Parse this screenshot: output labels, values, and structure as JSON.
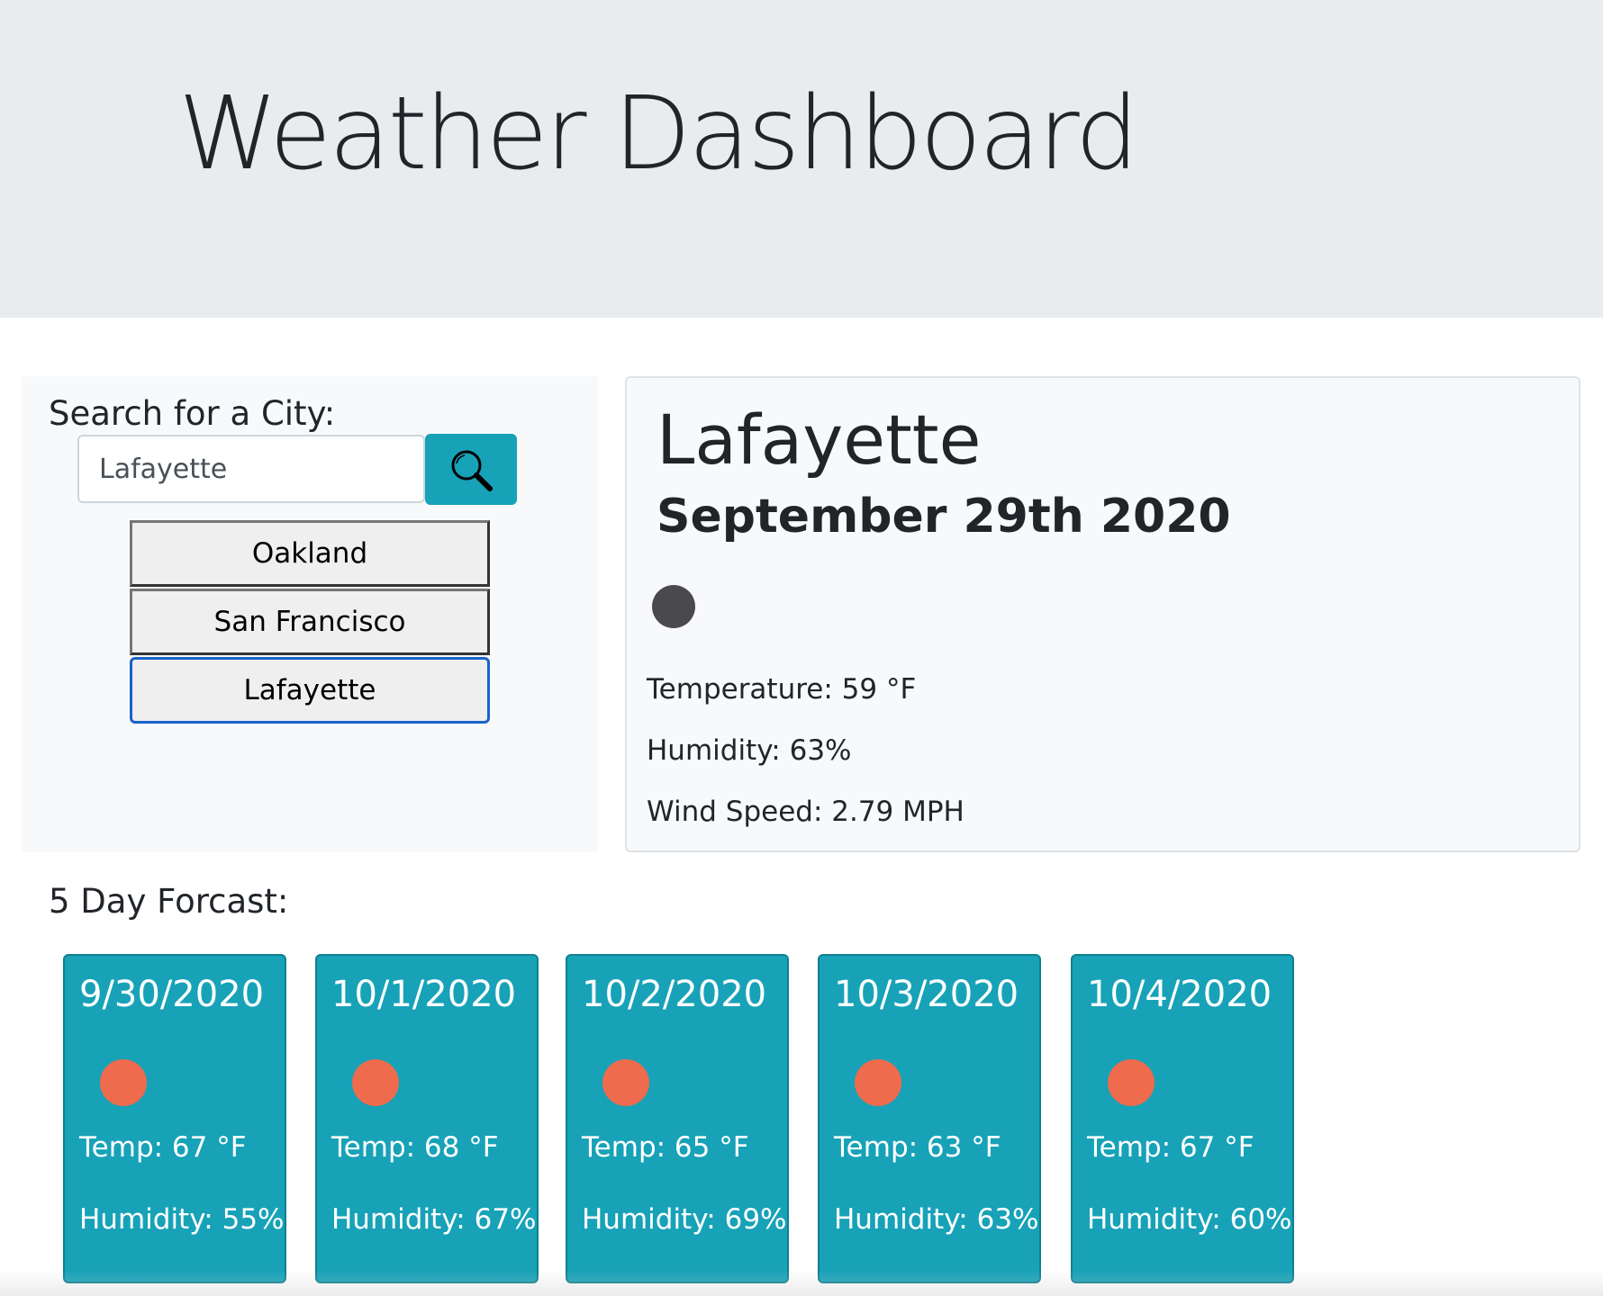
{
  "header": {
    "title": "Weather Dashboard"
  },
  "search": {
    "label": "Search for a City:",
    "input_value": "Lafayette",
    "button_icon": "search-icon",
    "history": [
      "Oakland",
      "San Francisco",
      "Lafayette"
    ],
    "active_history": "Lafayette"
  },
  "current": {
    "city": "Lafayette",
    "date": "September 29th 2020",
    "icon": "weather-icon",
    "temperature": "Temperature: 59 °F",
    "humidity": "Humidity: 63%",
    "wind": "Wind Speed: 2.79 MPH"
  },
  "forecast": {
    "label": "5 Day Forcast:",
    "days": [
      {
        "date": "9/30/2020",
        "temp": "Temp: 67 °F",
        "humidity": "Humidity: 55%",
        "icon": "sun-icon"
      },
      {
        "date": "10/1/2020",
        "temp": "Temp: 68 °F",
        "humidity": "Humidity: 67%",
        "icon": "sun-icon"
      },
      {
        "date": "10/2/2020",
        "temp": "Temp: 65 °F",
        "humidity": "Humidity: 69%",
        "icon": "sun-icon"
      },
      {
        "date": "10/3/2020",
        "temp": "Temp: 63 °F",
        "humidity": "Humidity: 63%",
        "icon": "sun-icon"
      },
      {
        "date": "10/4/2020",
        "temp": "Temp: 67 °F",
        "humidity": "Humidity: 60%",
        "icon": "sun-icon"
      }
    ]
  },
  "colors": {
    "jumbotron": "#e9ecef",
    "accent": "#17a2b8",
    "sun": "#ee6b4d",
    "current_icon": "#4a4a4d",
    "active_border": "#1a63c9"
  }
}
